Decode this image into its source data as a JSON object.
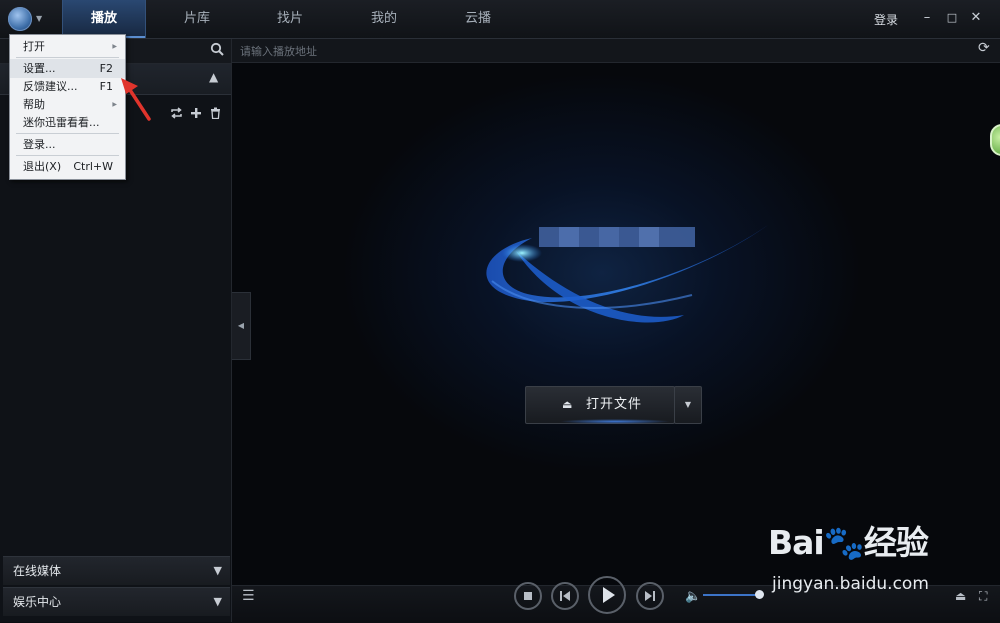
{
  "titlebar": {
    "tabs": [
      {
        "label": "播放",
        "active": true
      },
      {
        "label": "片库",
        "active": false
      },
      {
        "label": "找片",
        "active": false
      },
      {
        "label": "我的",
        "active": false
      },
      {
        "label": "云播",
        "active": false
      }
    ],
    "login": "登录",
    "window_buttons": {
      "minimize": "–",
      "maximize": "□",
      "close": "✕"
    }
  },
  "menu": {
    "items": [
      {
        "label": "打开",
        "shortcut": "",
        "submenu": true
      },
      {
        "label": "设置...",
        "shortcut": "F2",
        "submenu": false
      },
      {
        "label": "反馈建议...",
        "shortcut": "F1",
        "submenu": false
      },
      {
        "label": "帮助",
        "shortcut": "",
        "submenu": true
      },
      {
        "label": "迷你迅雷看看...",
        "shortcut": "",
        "submenu": false
      },
      {
        "label": "登录...",
        "shortcut": "",
        "submenu": false
      },
      {
        "label": "退出(X)",
        "shortcut": "Ctrl+W",
        "submenu": false
      }
    ],
    "submenu_glyph": "▶"
  },
  "left_panel": {
    "sections": [
      {
        "label": "在线媒体",
        "chevron": "▼"
      },
      {
        "label": "娱乐中心",
        "chevron": "▼"
      }
    ],
    "tool_icons": [
      "repeat-icon",
      "add-icon",
      "delete-icon"
    ]
  },
  "main": {
    "address_placeholder": "请输入播放地址",
    "open_file_label": "打开文件",
    "eject_glyph": "⏏",
    "dropdown_glyph": "▼"
  },
  "watermark": {
    "logo": "Bai🐾经验",
    "url": "jingyan.baidu.com"
  },
  "colors": {
    "accent": "#3c74c7",
    "active_tab": "#2a4872",
    "menu_bg": "#f2f3f5",
    "arrow": "#e0342c"
  }
}
